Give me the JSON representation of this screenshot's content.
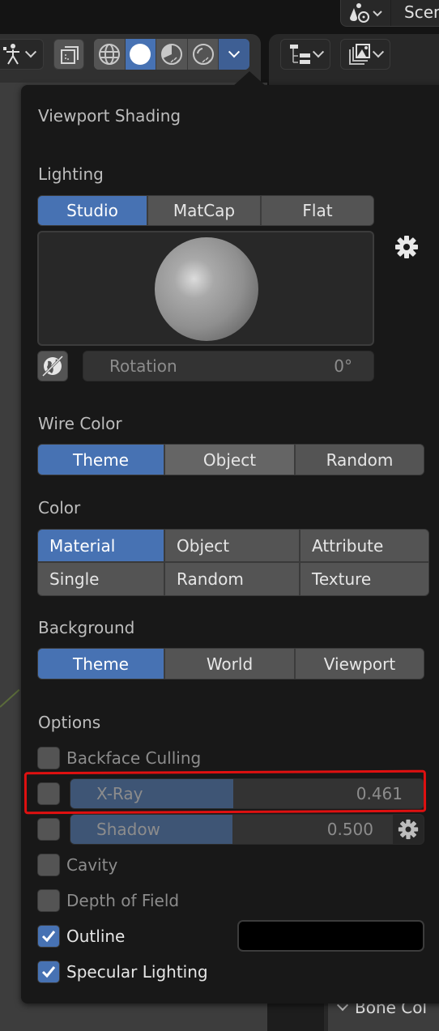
{
  "top_bar": {
    "scene_icon": "scene-icon",
    "scene_label": "Scene"
  },
  "viewport_header": {
    "buttons": [
      {
        "icon": "pose-armature-icon",
        "has_dropdown": true
      },
      {
        "icon": "object-overlay-icon",
        "has_dropdown": false
      }
    ],
    "shading_modes": [
      {
        "name": "wireframe",
        "icon": "wireframe-sphere-icon",
        "active": false
      },
      {
        "name": "solid",
        "icon": "solid-sphere-icon",
        "active": true
      },
      {
        "name": "material-preview",
        "icon": "material-sphere-icon",
        "active": false
      },
      {
        "name": "rendered",
        "icon": "rendered-sphere-icon",
        "active": false
      }
    ],
    "shading_dropdown_icon": "chevron-down-icon"
  },
  "outliner_header": {
    "buttons": [
      {
        "icon": "outliner-tree-icon",
        "has_dropdown": true
      },
      {
        "icon": "image-stack-icon",
        "has_dropdown": true
      }
    ],
    "row_label": "Bone Col"
  },
  "popover": {
    "title": "Viewport Shading",
    "lighting": {
      "label": "Lighting",
      "options": [
        "Studio",
        "MatCap",
        "Flat"
      ],
      "selected": "Studio",
      "preview_icon": "studio-sphere-preview",
      "settings_icon": "gear-icon",
      "world_space_icon": "world-icon",
      "rotation_label": "Rotation",
      "rotation_value": "0°"
    },
    "wire_color": {
      "label": "Wire Color",
      "options": [
        "Theme",
        "Object",
        "Random"
      ],
      "selected": "Theme",
      "hovered": "Object"
    },
    "color": {
      "label": "Color",
      "options": [
        "Material",
        "Object",
        "Attribute",
        "Single",
        "Random",
        "Texture"
      ],
      "selected": "Material"
    },
    "background": {
      "label": "Background",
      "options": [
        "Theme",
        "World",
        "Viewport"
      ],
      "selected": "Theme"
    },
    "options": {
      "label": "Options",
      "backface_culling": {
        "label": "Backface Culling",
        "checked": false
      },
      "xray": {
        "label": "X-Ray",
        "checked": false,
        "value": "0.461",
        "fraction": 0.461
      },
      "shadow": {
        "label": "Shadow",
        "checked": false,
        "value": "0.500",
        "fraction": 0.5,
        "settings_icon": "gear-icon"
      },
      "cavity": {
        "label": "Cavity",
        "checked": false
      },
      "depth_of_field": {
        "label": "Depth of Field",
        "checked": false
      },
      "outline": {
        "label": "Outline",
        "checked": true,
        "color": "#000000"
      },
      "specular_lighting": {
        "label": "Specular Lighting",
        "checked": true
      }
    }
  },
  "colors": {
    "accent": "#4772b3",
    "slider_fill": "#3e5575",
    "button": "#545454",
    "popover_bg": "#181818",
    "annotation": "#e01010"
  },
  "annotation": {
    "target": "X-Ray row",
    "shape": "hand-drawn red rectangle"
  }
}
